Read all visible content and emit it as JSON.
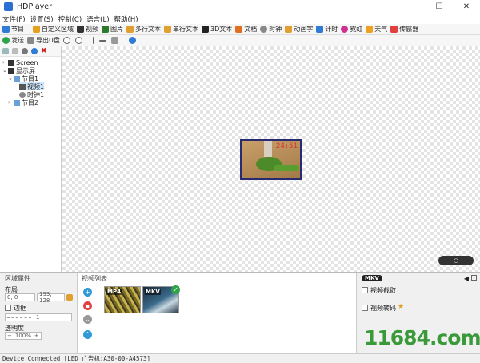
{
  "window": {
    "title": "HDPlayer",
    "minimize": "─",
    "maximize": "☐",
    "close": "✕"
  },
  "menu": [
    "文件(F)",
    "设置(S)",
    "控制(C)",
    "语言(L)",
    "帮助(H)"
  ],
  "toolbar1": [
    {
      "label": "节目",
      "color": "#2f7bd6"
    },
    {
      "label": "自定义区域",
      "color": "#e6a020"
    },
    {
      "label": "视频",
      "color": "#333333"
    },
    {
      "label": "图片",
      "color": "#2a7a2a"
    },
    {
      "label": "多行文本",
      "color": "#e0a030"
    },
    {
      "label": "单行文本",
      "color": "#e0a030"
    },
    {
      "label": "3D文本",
      "color": "#222222"
    },
    {
      "label": "文档",
      "color": "#e07020"
    },
    {
      "label": "时钟",
      "color": "#888888"
    },
    {
      "label": "动画字",
      "color": "#e0a030"
    },
    {
      "label": "计时",
      "color": "#2f7bd6"
    },
    {
      "label": "霓虹",
      "color": "#d03090"
    },
    {
      "label": "天气",
      "color": "#f0a020"
    },
    {
      "label": "传感器",
      "color": "#e04040"
    }
  ],
  "toolbar2": [
    {
      "label": "发送",
      "color": "#2fa34a"
    },
    {
      "label": "导出U盘",
      "color": "#888888"
    }
  ],
  "tree": {
    "items": [
      "Screen",
      "显示屏",
      "节目1",
      "视频1",
      "时钟1",
      "节目2"
    ]
  },
  "preview": {
    "clock": "24:51"
  },
  "props": {
    "title": "区域属性",
    "layout_label": "布局",
    "x": "0",
    "y": "0",
    "size": "193, 128",
    "border_label": "边框",
    "border_value": "1",
    "opacity_label": "透明度",
    "opacity_value": "100%"
  },
  "videolist": {
    "title": "视频列表",
    "items": [
      {
        "tag": "MP4"
      },
      {
        "tag": "MKV"
      }
    ]
  },
  "videoopts": {
    "badge": "MKV",
    "crop_label": "视频截取",
    "transcode_label": "视频转码"
  },
  "status": "Device Connected:[LED 广告机:A30-00-A4573]",
  "watermark": "11684.com"
}
